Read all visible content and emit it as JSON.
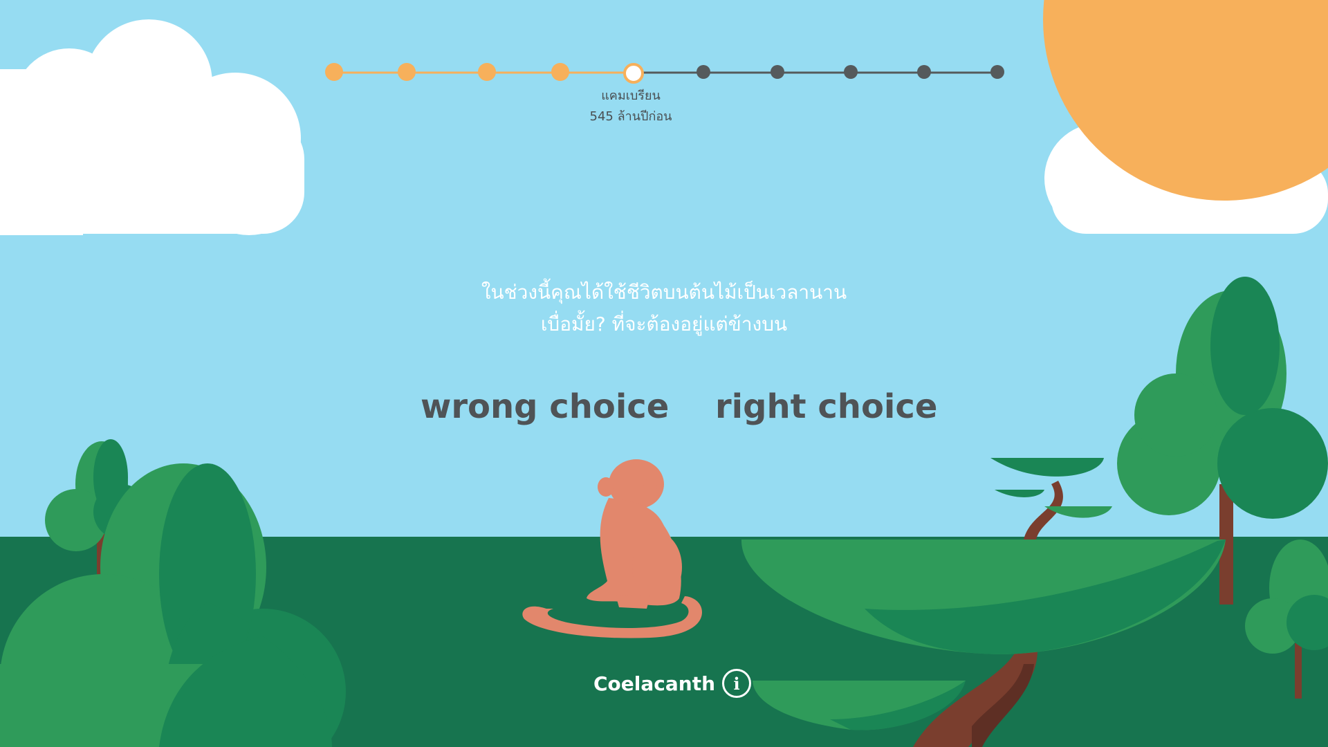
{
  "timeline": {
    "steps": [
      {
        "state": "done"
      },
      {
        "state": "done"
      },
      {
        "state": "done"
      },
      {
        "state": "done"
      },
      {
        "state": "current"
      },
      {
        "state": "future"
      },
      {
        "state": "future"
      },
      {
        "state": "future"
      },
      {
        "state": "future"
      },
      {
        "state": "future"
      }
    ],
    "current_era": "แคมเบรียน",
    "current_time": "545 ล้านปีก่อน"
  },
  "question": {
    "line1": "ในช่วงนี้คุณได้ใช้ชีวิตบนต้นไม้เป็นเวลานาน",
    "line2": "เบื่อมั้ย? ที่จะต้องอยู่แต่ข้างบน"
  },
  "choices": {
    "wrong_label": "wrong choice",
    "right_label": "right choice"
  },
  "footer": {
    "creature_name": "Coelacanth",
    "info_icon_glyph": "i"
  },
  "colors": {
    "sky": "#96dcf2",
    "ground": "#17744f",
    "sun": "#f7b05b",
    "tree_light": "#2f9b5a",
    "tree_dark": "#1a8655",
    "trunk": "#7a3e2e",
    "monkey": "#e2876c",
    "timeline_done": "#f7b05b",
    "timeline_future": "#555a5c"
  }
}
